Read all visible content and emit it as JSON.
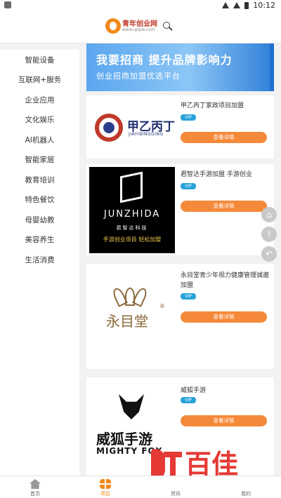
{
  "status_bar": {
    "time": "10:12",
    "icons": [
      "notification-icon",
      "wifi-icon",
      "signal-icon",
      "battery-icon"
    ]
  },
  "header": {
    "logo_text": "青年创业网",
    "logo_url": "www.qnpw.com",
    "search_icon": "search-icon"
  },
  "sidebar": {
    "categories": [
      {
        "label": "智能设备"
      },
      {
        "label": "互联网+服务"
      },
      {
        "label": "企业应用"
      },
      {
        "label": "文化娱乐"
      },
      {
        "label": "AI机器人"
      },
      {
        "label": "智能家居"
      },
      {
        "label": "教育培训"
      },
      {
        "label": "特色餐饮"
      },
      {
        "label": "母婴幼教"
      },
      {
        "label": "美容养生"
      },
      {
        "label": "生活消费"
      }
    ]
  },
  "banner": {
    "title": "我要招商  提升品牌影响力",
    "subtitle": "创业招商加盟优选平台"
  },
  "cards": [
    {
      "title": "甲乙丙丁家政项目加盟",
      "vip": "VIP",
      "button": "查看详情",
      "logo": {
        "brand": "甲乙丙丁",
        "pinyin": "JIAYIBINGDING"
      }
    },
    {
      "title": "君智达手游加盟 手游创业",
      "vip": "VIP",
      "button": "查看详情",
      "logo": {
        "brand": "JUNZHIDA",
        "brand_cn": "君智达科技",
        "slogan": "手游创业项目 轻松加盟"
      }
    },
    {
      "title": "永目堂青少年视力健康管理诚邀加盟",
      "vip": "VIP",
      "button": "查看详情",
      "logo": {
        "brand": "永目堂",
        "mark": "®"
      }
    },
    {
      "title": "威狐手游",
      "vip": "VIP",
      "button": "查看详情",
      "logo": {
        "brand": "威狐手游",
        "brand_en": "MIGHTY FOX"
      }
    }
  ],
  "float_buttons": {
    "home_icon": "⌂",
    "top_icon": "⤒",
    "back_icon": "↶"
  },
  "watermark": {
    "text": "百佳"
  },
  "bottom_nav": {
    "items": [
      {
        "label": "首页",
        "icon": "home-icon"
      },
      {
        "label": "项目",
        "icon": "grid-icon",
        "active": true
      },
      {
        "label": "资讯",
        "icon": "news-icon"
      },
      {
        "label": "我的",
        "icon": "user-icon"
      }
    ]
  },
  "colors": {
    "accent": "#f5893a",
    "vip": "#29a3d9",
    "banner": "#5aa6ee",
    "watermark": "#e53935"
  }
}
